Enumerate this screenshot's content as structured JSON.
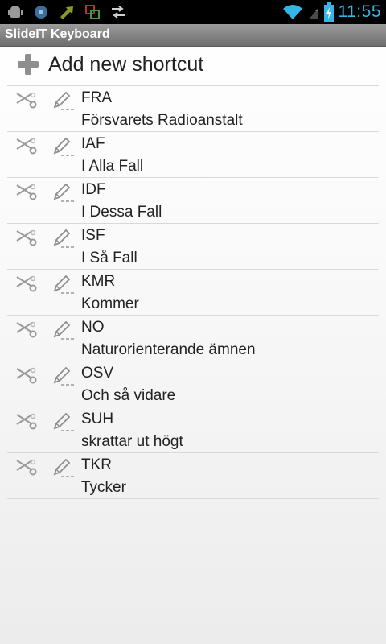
{
  "status_bar": {
    "time": "11:55",
    "left_icons": [
      "android-debug-icon",
      "app-icon",
      "sync-arrow-icon",
      "screen-capture-icon",
      "shuffle-icon"
    ],
    "right_icons": [
      "wifi-icon",
      "signal-icon",
      "battery-charging-icon"
    ],
    "accent_color": "#33b5e5"
  },
  "app": {
    "title": "SlideIT Keyboard"
  },
  "add": {
    "label": "Add new shortcut"
  },
  "shortcuts": [
    {
      "abbr": "FRA",
      "full": "Försvarets Radioanstalt"
    },
    {
      "abbr": "IAF",
      "full": "I Alla Fall"
    },
    {
      "abbr": "IDF",
      "full": "I Dessa Fall"
    },
    {
      "abbr": "ISF",
      "full": "I Så Fall"
    },
    {
      "abbr": "KMR",
      "full": "Kommer"
    },
    {
      "abbr": "NO",
      "full": "Naturorienterande ämnen"
    },
    {
      "abbr": "OSV",
      "full": "Och så vidare"
    },
    {
      "abbr": "SUH",
      "full": "skrattar ut högt"
    },
    {
      "abbr": "TKR",
      "full": "Tycker"
    }
  ]
}
